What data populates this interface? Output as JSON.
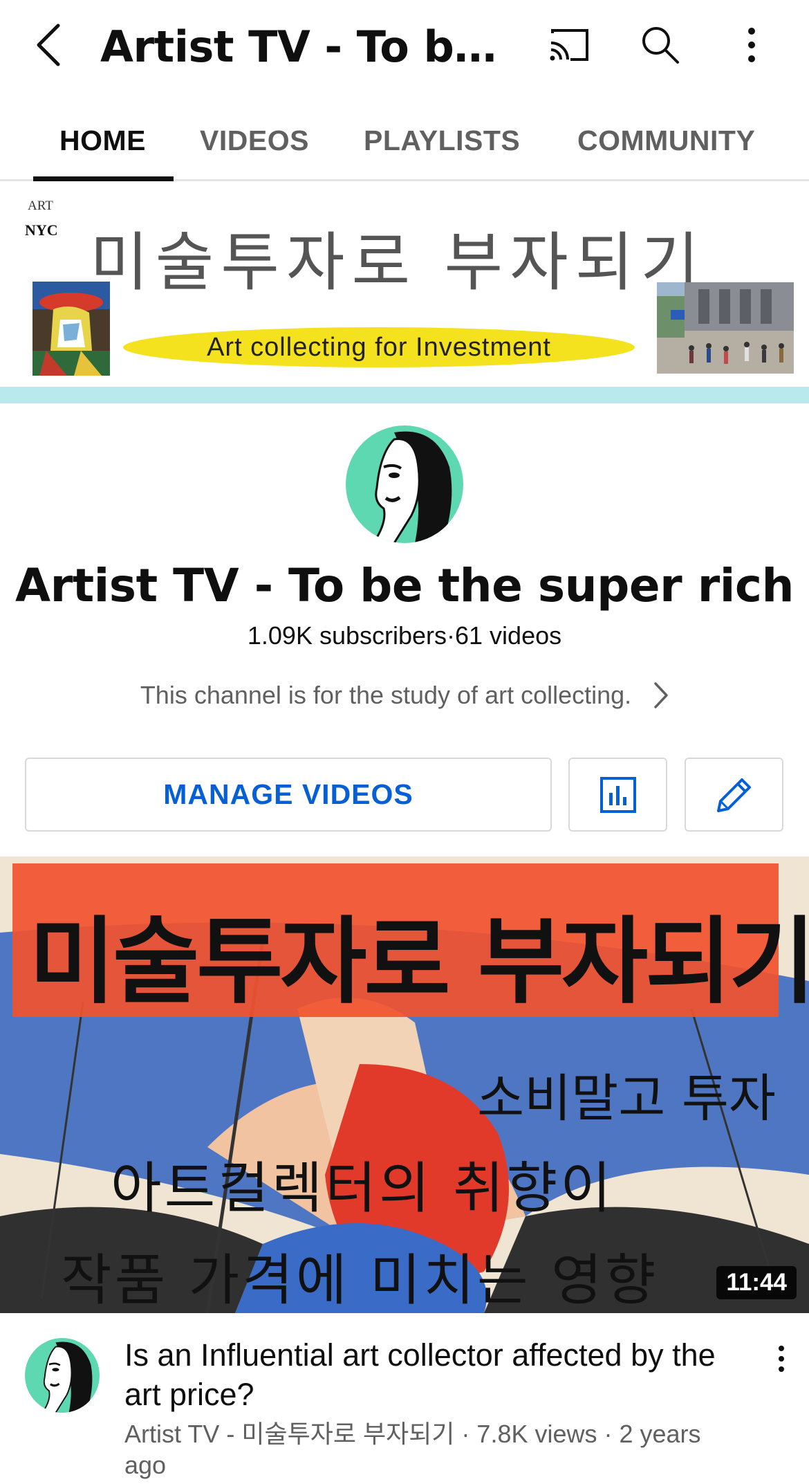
{
  "header": {
    "title": "Artist TV - To be the super rich",
    "back_icon": "chevron-left-icon",
    "cast_icon": "cast-icon",
    "search_icon": "search-icon",
    "menu_icon": "more-vert-icon"
  },
  "tabs": [
    {
      "label": "HOME",
      "active": true
    },
    {
      "label": "VIDEOS",
      "active": false
    },
    {
      "label": "PLAYLISTS",
      "active": false
    },
    {
      "label": "COMMUNITY",
      "active": false
    }
  ],
  "banner": {
    "art_label": "ART",
    "nyc_label": "NYC",
    "korean_title": "미술투자로 부자되기",
    "tagline": "Art collecting for Investment",
    "colors": {
      "pill": "#f5e21f",
      "strip": "#b9e9ec"
    }
  },
  "channel": {
    "name": "Artist TV - To be the super rich",
    "subscribers": "1.09K subscribers",
    "separator": "·",
    "video_count": "61 videos",
    "description": "This channel is for the study of art collecting."
  },
  "actions": {
    "manage_label": "MANAGE VIDEOS",
    "stats_icon": "analytics-icon",
    "edit_icon": "pencil-icon",
    "accent_color": "#065fd4"
  },
  "video": {
    "thumbnail_text": {
      "line1": "미술투자로 부자되기",
      "line2": "소비말고 투자",
      "line3": "아트컬렉터의 취향이",
      "line4": "작품 가격에 미치는 영향"
    },
    "duration": "11:44",
    "title": "Is an Influential art collector affected by the art price?",
    "meta": "Artist TV - 미술투자로 부자되기 · 7.8K views · 2 years ago"
  }
}
